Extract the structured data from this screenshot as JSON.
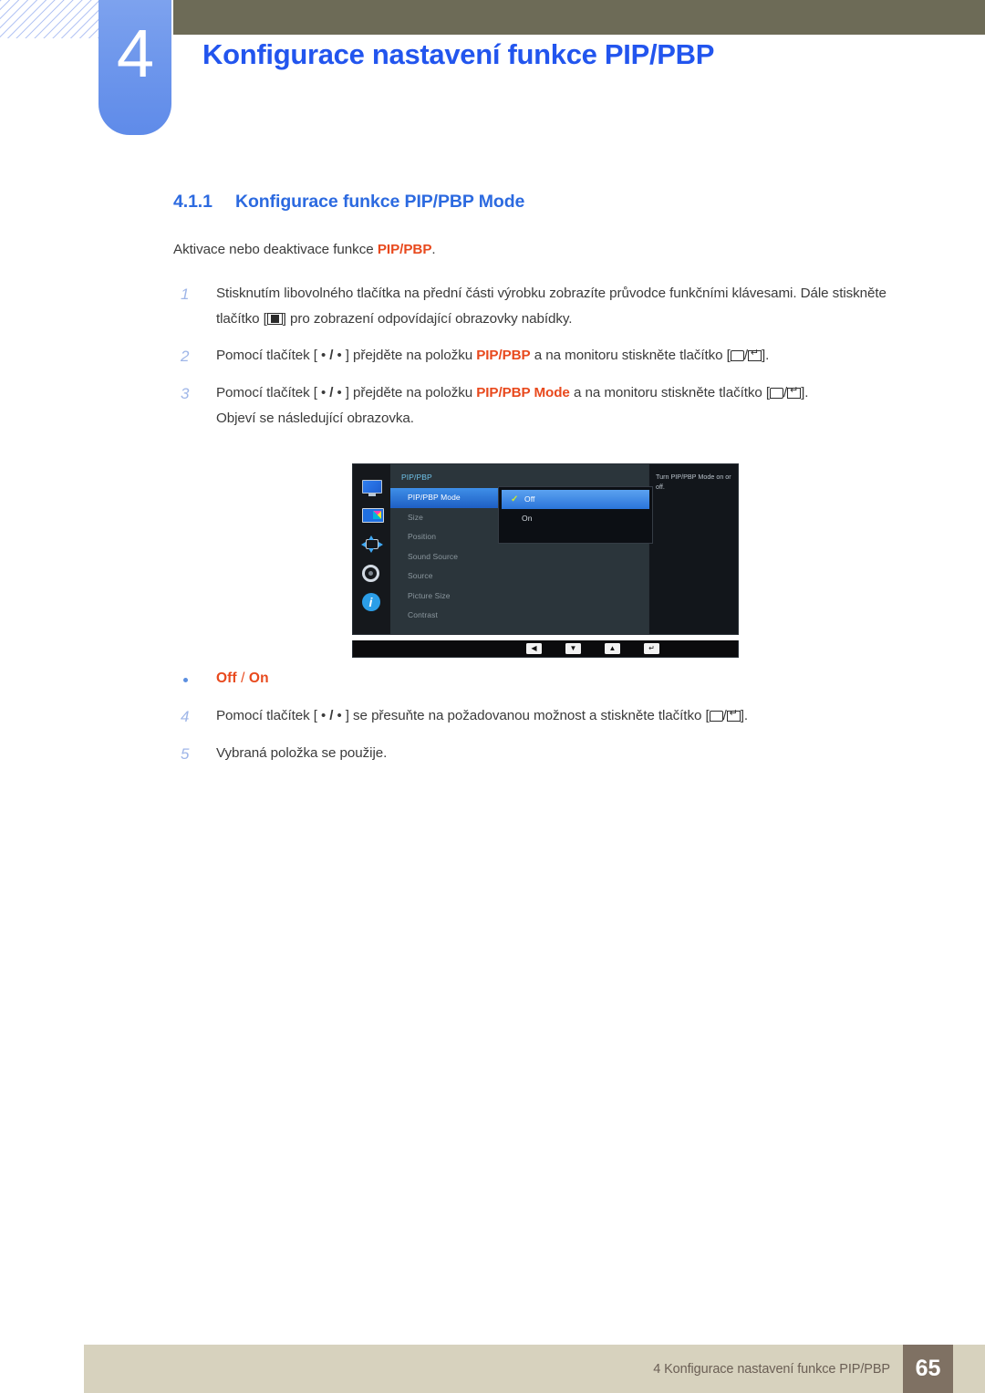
{
  "header": {
    "chapter_number": "4",
    "chapter_title": "Konfigurace nastavení funkce PIP/PBP"
  },
  "section": {
    "number": "4.1.1",
    "title": "Konfigurace funkce PIP/PBP Mode",
    "intro_before": "Aktivace nebo deaktivace funkce ",
    "intro_highlight": "PIP/PBP",
    "intro_after": "."
  },
  "steps": [
    {
      "index": "1",
      "part1": "Stisknutím libovolného tlačítka na přední části výrobku zobrazíte průvodce funkčními klávesami. Dále stiskněte tlačítko [",
      "part2": "] pro zobrazení odpovídající obrazovky nabídky."
    },
    {
      "index": "2",
      "part1": "Pomocí tlačítek [",
      "part2": "] přejděte na položku ",
      "highlight": "PIP/PBP",
      "part3": " a na monitoru stiskněte tlačítko [",
      "part4": "]."
    },
    {
      "index": "3",
      "part1": "Pomocí tlačítek [",
      "part2": "] přejděte na položku ",
      "highlight": "PIP/PBP Mode",
      "part3": " a na monitoru stiskněte tlačítko [",
      "part4": "].",
      "note": "Objeví se následující obrazovka."
    },
    {
      "index": "4",
      "part1": "Pomocí tlačítek [",
      "part2": "] se přesuňte na požadovanou možnost a stiskněte tlačítko [",
      "part3": "]."
    },
    {
      "index": "5",
      "part1": "Vybraná položka se použije."
    }
  ],
  "options_line": {
    "first": "Off",
    "separator": " / ",
    "second": "On"
  },
  "osd": {
    "icons": [
      "monitor-icon",
      "pip-pbp-icon",
      "position-arrows-icon",
      "gear-icon",
      "info-icon"
    ],
    "menu_title": "PIP/PBP",
    "menu_items": [
      "PIP/PBP Mode",
      "Size",
      "Position",
      "Sound Source",
      "Source",
      "Picture Size",
      "Contrast"
    ],
    "selected_item": "PIP/PBP Mode",
    "submenu": {
      "options": [
        "Off",
        "On"
      ],
      "checked": "Off"
    },
    "help_text": "Turn PIP/PBP Mode on or off.",
    "keybar": [
      "◀",
      "▼",
      "▲",
      "↵"
    ]
  },
  "footer": {
    "text": "4 Konfigurace nastavení funkce PIP/PBP",
    "page": "65"
  },
  "colors": {
    "chapter_blue": "#2255ee",
    "heading_blue": "#2c6ae0",
    "highlight_orange": "#e8491d",
    "olive_band": "#6d6b57",
    "footer_band": "#d7d2be",
    "page_box": "#7f7163",
    "tab_blue": "#6e97ec"
  }
}
